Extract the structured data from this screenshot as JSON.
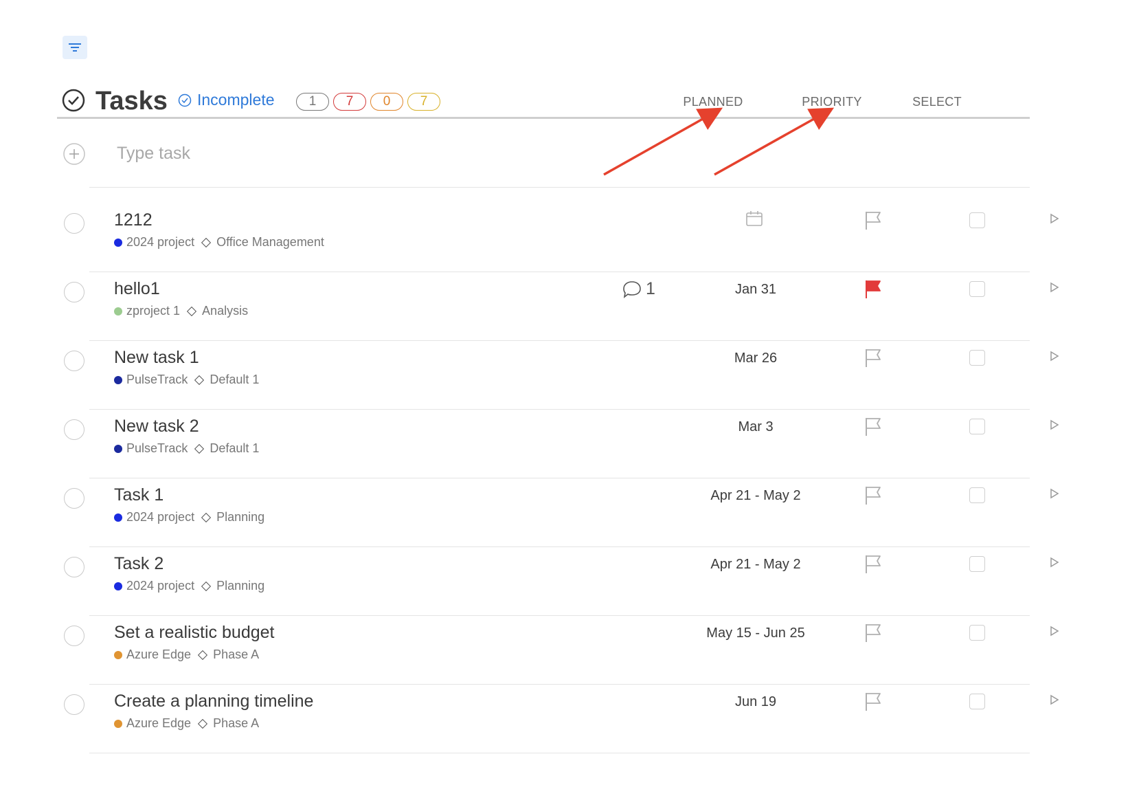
{
  "header": {
    "title": "Tasks",
    "filter_label": "Incomplete",
    "badges": [
      {
        "value": "1",
        "color": "#777777"
      },
      {
        "value": "7",
        "color": "#d33a3a"
      },
      {
        "value": "0",
        "color": "#e0852b"
      },
      {
        "value": "7",
        "color": "#d8b12a"
      }
    ],
    "columns": {
      "planned": "PLANNED",
      "priority": "PRIORITY",
      "select": "SELECT"
    }
  },
  "add_task": {
    "placeholder": "Type task"
  },
  "tasks": [
    {
      "name": "1212",
      "project": "2024 project",
      "section": "Office Management",
      "project_color": "#1a2be0",
      "planned": "",
      "flagged": false,
      "comments": ""
    },
    {
      "name": "hello1",
      "project": "zproject 1",
      "section": "Analysis",
      "project_color": "#9ccc90",
      "planned": "Jan 31",
      "flagged": true,
      "comments": "1"
    },
    {
      "name": "New task 1",
      "project": "PulseTrack",
      "section": "Default 1",
      "project_color": "#1b2a9e",
      "planned": "Mar 26",
      "flagged": false,
      "comments": ""
    },
    {
      "name": "New task 2",
      "project": "PulseTrack",
      "section": "Default 1",
      "project_color": "#1b2a9e",
      "planned": "Mar 3",
      "flagged": false,
      "comments": ""
    },
    {
      "name": "Task 1",
      "project": "2024 project",
      "section": "Planning",
      "project_color": "#1a2be0",
      "planned": "Apr 21 - May 2",
      "flagged": false,
      "comments": ""
    },
    {
      "name": "Task 2",
      "project": "2024 project",
      "section": "Planning",
      "project_color": "#1a2be0",
      "planned": "Apr 21 - May 2",
      "flagged": false,
      "comments": ""
    },
    {
      "name": "Set a realistic budget",
      "project": "Azure Edge",
      "section": "Phase A",
      "project_color": "#e09432",
      "planned": "May 15 - Jun 25",
      "flagged": false,
      "comments": ""
    },
    {
      "name": "Create a planning timeline",
      "project": "Azure Edge",
      "section": "Phase A",
      "project_color": "#e09432",
      "planned": "Jun 19",
      "flagged": false,
      "comments": ""
    }
  ],
  "colors": {
    "accent": "#2f7ad9",
    "flag_red": "#e23b3b",
    "annotation_arrow": "#e5412d"
  }
}
